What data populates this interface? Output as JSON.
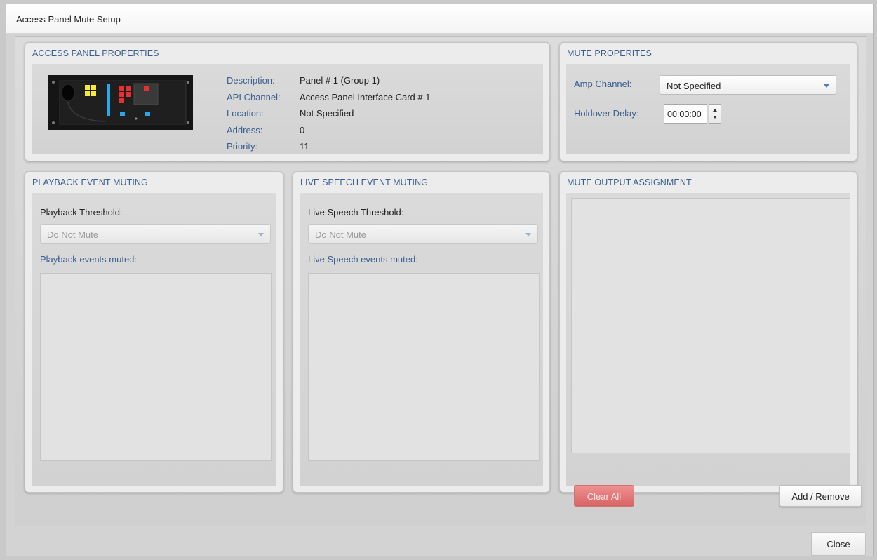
{
  "window": {
    "title": "Access Panel Mute Setup"
  },
  "access_panel": {
    "header": "ACCESS PANEL PROPERTIES",
    "labels": {
      "description": "Description:",
      "api_channel": "API Channel:",
      "location": "Location:",
      "address": "Address:",
      "priority": "Priority:"
    },
    "values": {
      "description": "Panel # 1 (Group 1)",
      "api_channel": "Access Panel Interface Card # 1",
      "location": "Not Specified",
      "address": "0",
      "priority": "11"
    }
  },
  "mute_properties": {
    "header": "MUTE PROPERITES",
    "amp_channel_label": "Amp Channel:",
    "amp_channel_value": "Not Specified",
    "holdover_label": "Holdover Delay:",
    "holdover_value": "00:00:00"
  },
  "playback": {
    "header": "PLAYBACK EVENT MUTING",
    "threshold_label": "Playback Threshold:",
    "threshold_value": "Do Not Mute",
    "muted_label": "Playback events muted:"
  },
  "live_speech": {
    "header": "LIVE SPEECH EVENT MUTING",
    "threshold_label": "Live Speech Threshold:",
    "threshold_value": "Do Not Mute",
    "muted_label": "Live Speech events muted:"
  },
  "mute_output": {
    "header": "MUTE OUTPUT ASSIGNMENT",
    "clear_label": "Clear All",
    "add_remove_label": "Add / Remove"
  },
  "footer": {
    "close_label": "Close"
  },
  "colors": {
    "header_blue": "#3a5f8f",
    "clear_button": "#e07878",
    "panel_bg": "#ececec"
  }
}
